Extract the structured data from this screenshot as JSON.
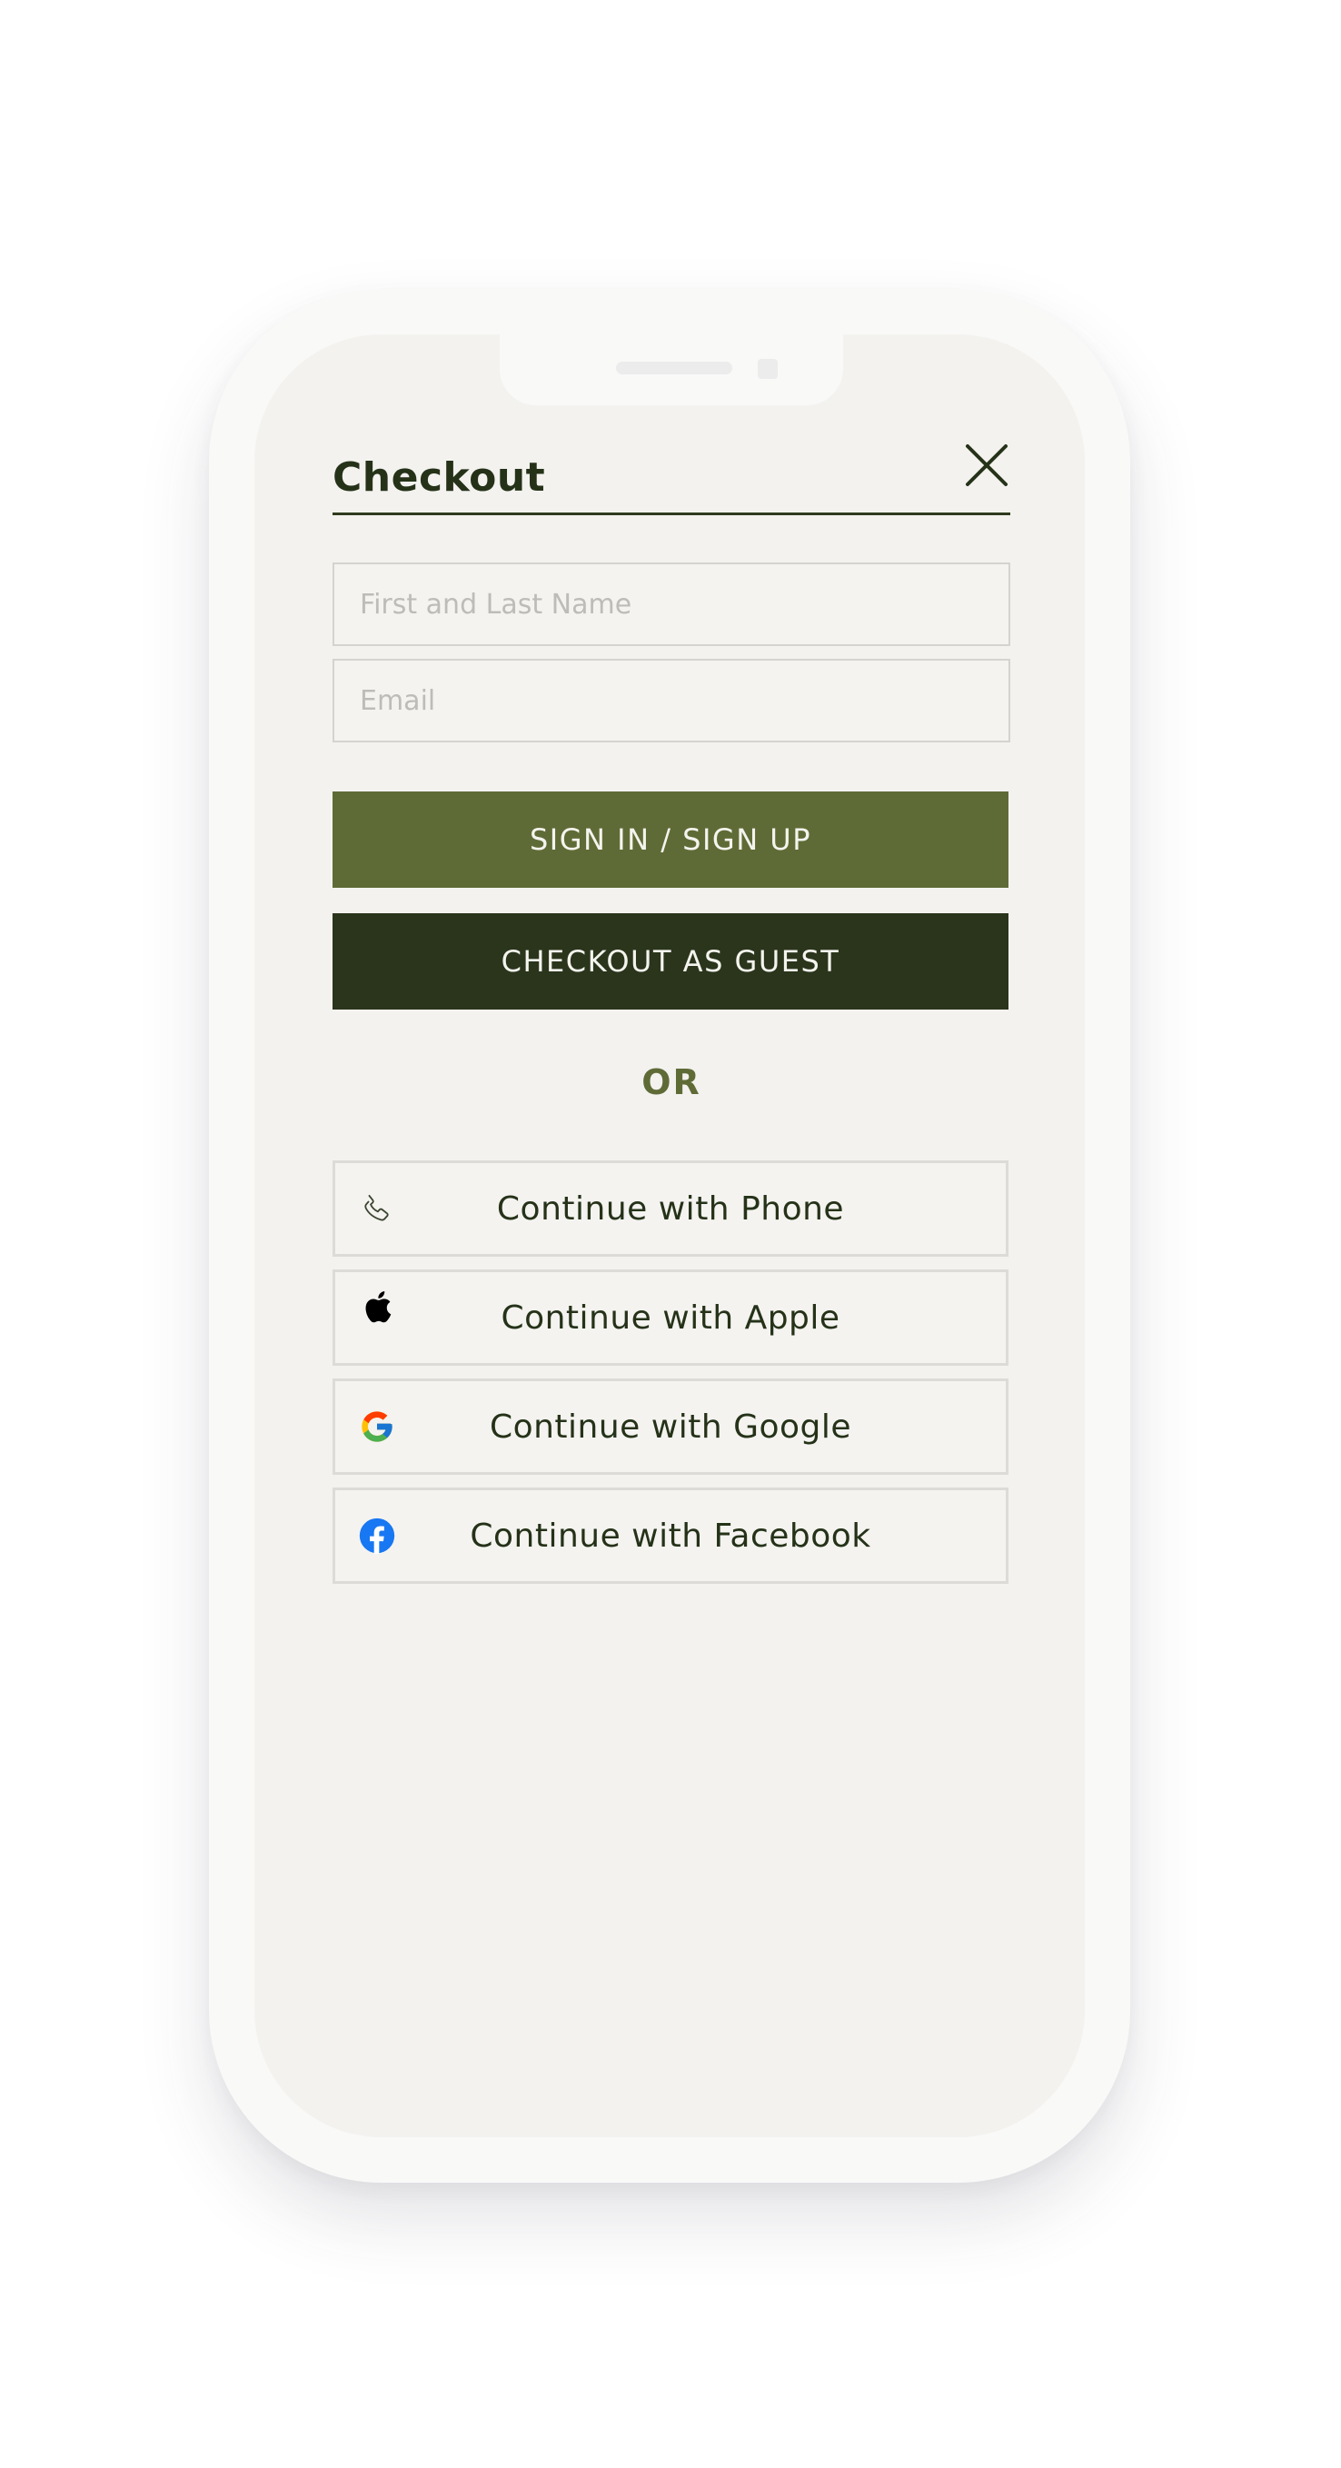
{
  "checkout": {
    "title": "Checkout"
  },
  "form": {
    "name_placeholder": "First and Last Name",
    "email_placeholder": "Email"
  },
  "buttons": {
    "signin_label": "SIGN IN / SIGN UP",
    "guest_label": "CHECKOUT AS GUEST"
  },
  "divider": {
    "or_label": "OR"
  },
  "social": [
    {
      "label": "Continue with Phone",
      "icon": "phone-icon"
    },
    {
      "label": "Continue with Apple",
      "icon": "apple-icon"
    },
    {
      "label": "Continue with Google",
      "icon": "google-icon"
    },
    {
      "label": "Continue with Facebook",
      "icon": "facebook-icon"
    }
  ],
  "colors": {
    "accent_olive": "#5f6b36",
    "dark_green": "#2a351c",
    "screen_background": "#f3f2ef",
    "facebook_blue": "#1877f2"
  }
}
